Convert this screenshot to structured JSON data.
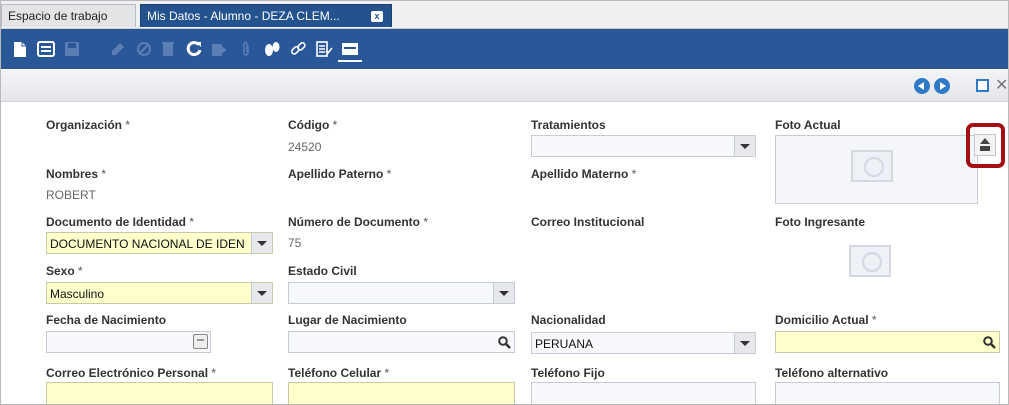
{
  "tabs": {
    "workspace": "Espacio de trabajo",
    "active": "Mis Datos - Alumno - DEZA CLEM...",
    "close": "x"
  },
  "toolbar_icons": [
    "new-record-icon",
    "detail-icon",
    "save-icon",
    "discard-icon",
    "cancel-icon",
    "delete-icon",
    "refresh-icon",
    "export-icon",
    "attach-icon",
    "history-icon",
    "link-icon",
    "checklist-icon",
    "form-view-icon"
  ],
  "nav": {
    "x_glyph": "✕"
  },
  "form": {
    "organizacion": {
      "label": "Organización",
      "req": " *"
    },
    "codigo": {
      "label": "Código",
      "req": " *",
      "value": "24520"
    },
    "tratamientos": {
      "label": "Tratamientos",
      "value": ""
    },
    "foto_actual": {
      "label": "Foto Actual"
    },
    "nombres": {
      "label": "Nombres",
      "req": " *",
      "value": "ROBERT"
    },
    "apellido_paterno": {
      "label": "Apellido Paterno",
      "req": " *"
    },
    "apellido_materno": {
      "label": "Apellido Materno",
      "req": " *"
    },
    "documento_identidad": {
      "label": "Documento de Identidad",
      "req": " *",
      "value": "DOCUMENTO NACIONAL DE IDEN"
    },
    "numero_documento": {
      "label": "Número de Documento",
      "req": " *",
      "value": "75"
    },
    "correo_institucional": {
      "label": "Correo Institucional"
    },
    "foto_ingresante": {
      "label": "Foto Ingresante"
    },
    "sexo": {
      "label": "Sexo",
      "req": " *",
      "value": "Masculino"
    },
    "estado_civil": {
      "label": "Estado Civil",
      "value": ""
    },
    "fecha_nacimiento": {
      "label": "Fecha de Nacimiento",
      "value": ""
    },
    "lugar_nacimiento": {
      "label": "Lugar de Nacimiento",
      "value": ""
    },
    "nacionalidad": {
      "label": "Nacionalidad",
      "value": "PERUANA"
    },
    "domicilio_actual": {
      "label": "Domicilio Actual",
      "req": " *",
      "value": ""
    },
    "correo_personal": {
      "label": "Correo Electrónico Personal",
      "req": " *",
      "value": ""
    },
    "telefono_celular": {
      "label": "Teléfono Celular",
      "req": " *",
      "value": ""
    },
    "telefono_fijo": {
      "label": "Teléfono Fijo",
      "value": ""
    },
    "telefono_alternativo": {
      "label": "Teléfono alternativo",
      "value": ""
    }
  },
  "colors": {
    "toolbar": "#2a5797",
    "active_tab": "#23528f",
    "required_field": "#ffffcc",
    "highlight": "#a40f14"
  }
}
